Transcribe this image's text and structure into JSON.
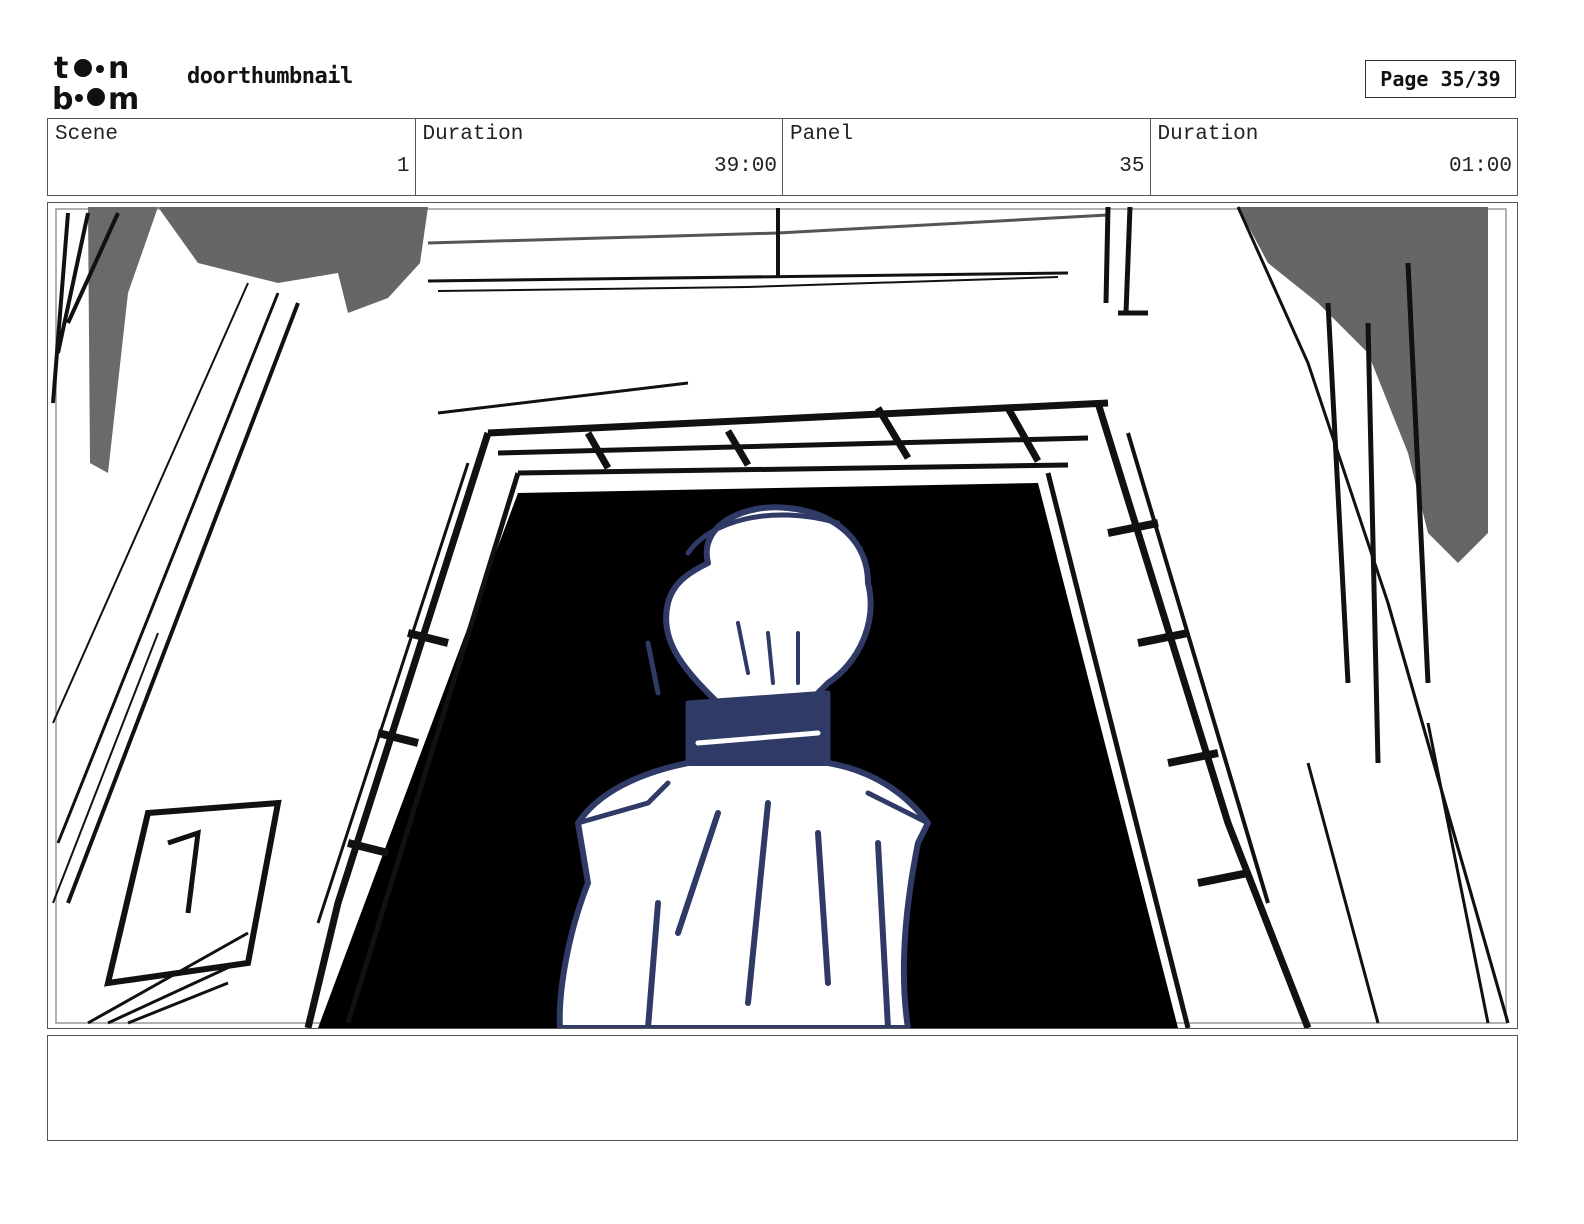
{
  "header": {
    "logo_text": "toon boom",
    "project_title": "doorthumbnail",
    "page_label": "Page 35/39"
  },
  "info": [
    {
      "label": "Scene",
      "value": "1"
    },
    {
      "label": "Duration",
      "value": "39:00"
    },
    {
      "label": "Panel",
      "value": "35"
    },
    {
      "label": "Duration",
      "value": "01:00"
    }
  ],
  "panel": {
    "description": "",
    "figure_color": "#2f3a66"
  },
  "notes": {
    "text": ""
  }
}
